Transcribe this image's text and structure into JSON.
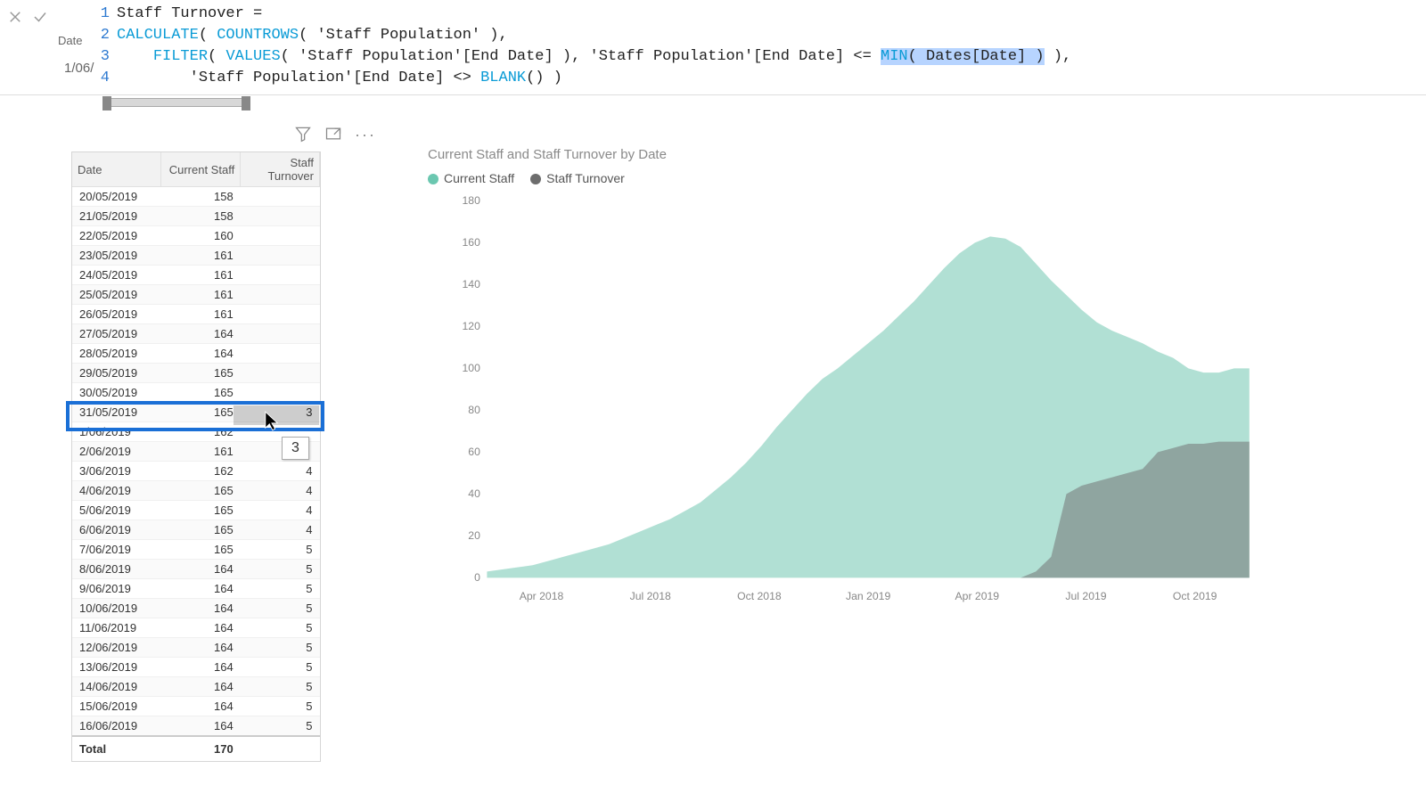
{
  "formula": {
    "measure_name": "Staff Turnover",
    "line1": "Staff Turnover =",
    "calc": "CALCULATE",
    "countrows": "COUNTROWS",
    "filter": "FILTER",
    "values": "VALUES",
    "min": "MIN",
    "blank": "BLANK",
    "tbl": "'Staff Population'",
    "col_end": "'Staff Population'[End Date]",
    "dates": "Dates[Date]",
    "floating_label": "Date",
    "floating_value": "1/06/"
  },
  "table": {
    "headers": [
      "Date",
      "Current Staff",
      "Staff Turnover"
    ],
    "rows": [
      {
        "d": "20/05/2019",
        "c": "158",
        "t": ""
      },
      {
        "d": "21/05/2019",
        "c": "158",
        "t": ""
      },
      {
        "d": "22/05/2019",
        "c": "160",
        "t": ""
      },
      {
        "d": "23/05/2019",
        "c": "161",
        "t": ""
      },
      {
        "d": "24/05/2019",
        "c": "161",
        "t": ""
      },
      {
        "d": "25/05/2019",
        "c": "161",
        "t": ""
      },
      {
        "d": "26/05/2019",
        "c": "161",
        "t": ""
      },
      {
        "d": "27/05/2019",
        "c": "164",
        "t": ""
      },
      {
        "d": "28/05/2019",
        "c": "164",
        "t": ""
      },
      {
        "d": "29/05/2019",
        "c": "165",
        "t": ""
      },
      {
        "d": "30/05/2019",
        "c": "165",
        "t": ""
      },
      {
        "d": "31/05/2019",
        "c": "165",
        "t": "3"
      },
      {
        "d": "1/06/2019",
        "c": "162",
        "t": ""
      },
      {
        "d": "2/06/2019",
        "c": "161",
        "t": ""
      },
      {
        "d": "3/06/2019",
        "c": "162",
        "t": "4"
      },
      {
        "d": "4/06/2019",
        "c": "165",
        "t": "4"
      },
      {
        "d": "5/06/2019",
        "c": "165",
        "t": "4"
      },
      {
        "d": "6/06/2019",
        "c": "165",
        "t": "4"
      },
      {
        "d": "7/06/2019",
        "c": "165",
        "t": "5"
      },
      {
        "d": "8/06/2019",
        "c": "164",
        "t": "5"
      },
      {
        "d": "9/06/2019",
        "c": "164",
        "t": "5"
      },
      {
        "d": "10/06/2019",
        "c": "164",
        "t": "5"
      },
      {
        "d": "11/06/2019",
        "c": "164",
        "t": "5"
      },
      {
        "d": "12/06/2019",
        "c": "164",
        "t": "5"
      },
      {
        "d": "13/06/2019",
        "c": "164",
        "t": "5"
      },
      {
        "d": "14/06/2019",
        "c": "164",
        "t": "5"
      },
      {
        "d": "15/06/2019",
        "c": "164",
        "t": "5"
      },
      {
        "d": "16/06/2019",
        "c": "164",
        "t": "5"
      }
    ],
    "total_label": "Total",
    "total_value": "170",
    "highlight_row_index": 11,
    "tooltip_value": "3"
  },
  "chart_data": {
    "type": "area",
    "title": "Current Staff and Staff Turnover by Date",
    "ylabel": "",
    "xlabel": "",
    "ylim": [
      0,
      180
    ],
    "y_ticks": [
      0,
      20,
      40,
      60,
      80,
      100,
      120,
      140,
      160,
      180
    ],
    "x_ticks": [
      "Apr 2018",
      "Jul 2018",
      "Oct 2018",
      "Jan 2019",
      "Apr 2019",
      "Jul 2019",
      "Oct 2019"
    ],
    "series": [
      {
        "name": "Current Staff",
        "color": "#6bc7b0",
        "points": [
          [
            0,
            3
          ],
          [
            2,
            4
          ],
          [
            4,
            5
          ],
          [
            6,
            6
          ],
          [
            8,
            8
          ],
          [
            10,
            10
          ],
          [
            12,
            12
          ],
          [
            14,
            14
          ],
          [
            16,
            16
          ],
          [
            18,
            19
          ],
          [
            20,
            22
          ],
          [
            22,
            25
          ],
          [
            24,
            28
          ],
          [
            26,
            32
          ],
          [
            28,
            36
          ],
          [
            30,
            42
          ],
          [
            32,
            48
          ],
          [
            34,
            55
          ],
          [
            36,
            63
          ],
          [
            38,
            72
          ],
          [
            40,
            80
          ],
          [
            42,
            88
          ],
          [
            44,
            95
          ],
          [
            46,
            100
          ],
          [
            48,
            106
          ],
          [
            50,
            112
          ],
          [
            52,
            118
          ],
          [
            54,
            125
          ],
          [
            56,
            132
          ],
          [
            58,
            140
          ],
          [
            60,
            148
          ],
          [
            62,
            155
          ],
          [
            64,
            160
          ],
          [
            66,
            163
          ],
          [
            68,
            162
          ],
          [
            70,
            158
          ],
          [
            72,
            150
          ],
          [
            74,
            142
          ],
          [
            76,
            135
          ],
          [
            78,
            128
          ],
          [
            80,
            122
          ],
          [
            82,
            118
          ],
          [
            84,
            115
          ],
          [
            86,
            112
          ],
          [
            88,
            108
          ],
          [
            90,
            105
          ],
          [
            92,
            100
          ],
          [
            94,
            98
          ],
          [
            96,
            98
          ],
          [
            98,
            100
          ],
          [
            100,
            100
          ]
        ]
      },
      {
        "name": "Staff Turnover",
        "color": "#6d6d6d",
        "points": [
          [
            70,
            0
          ],
          [
            72,
            3
          ],
          [
            74,
            10
          ],
          [
            76,
            40
          ],
          [
            78,
            44
          ],
          [
            80,
            46
          ],
          [
            82,
            48
          ],
          [
            84,
            50
          ],
          [
            86,
            52
          ],
          [
            88,
            60
          ],
          [
            90,
            62
          ],
          [
            92,
            64
          ],
          [
            94,
            64
          ],
          [
            96,
            65
          ],
          [
            98,
            65
          ],
          [
            100,
            65
          ]
        ]
      }
    ]
  }
}
